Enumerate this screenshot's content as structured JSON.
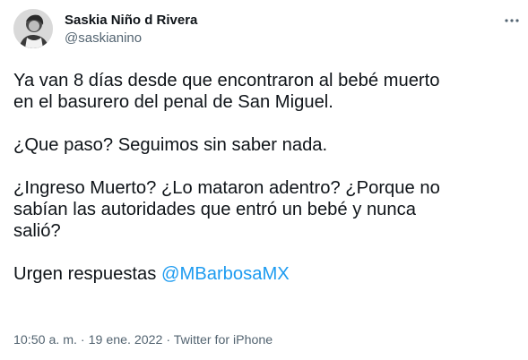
{
  "author": {
    "display_name": "Saskia Niño d Rivera",
    "handle": "@saskianino",
    "avatar_icon": "user-avatar"
  },
  "more_icon": "more-horizontal-icon",
  "tweet": {
    "para1": "Ya van 8 días desde que encontraron al bebé muerto\nen el basurero del penal de San Miguel.",
    "para2": "¿Que paso? Seguimos sin saber nada.",
    "para3": "¿Ingreso Muerto? ¿Lo mataron adentro? ¿Porque no\nsabían las autoridades que entró un bebé y nunca\nsalió?",
    "para4_prefix": "Urgen respuestas ",
    "mention": "@MBarbosaMX"
  },
  "meta": {
    "time": "10:50 a. m.",
    "separator": " · ",
    "date": "19 ene. 2022",
    "client": "Twitter for iPhone"
  },
  "colors": {
    "text": "#0f1419",
    "secondary": "#536471",
    "link": "#1d9bf0"
  }
}
